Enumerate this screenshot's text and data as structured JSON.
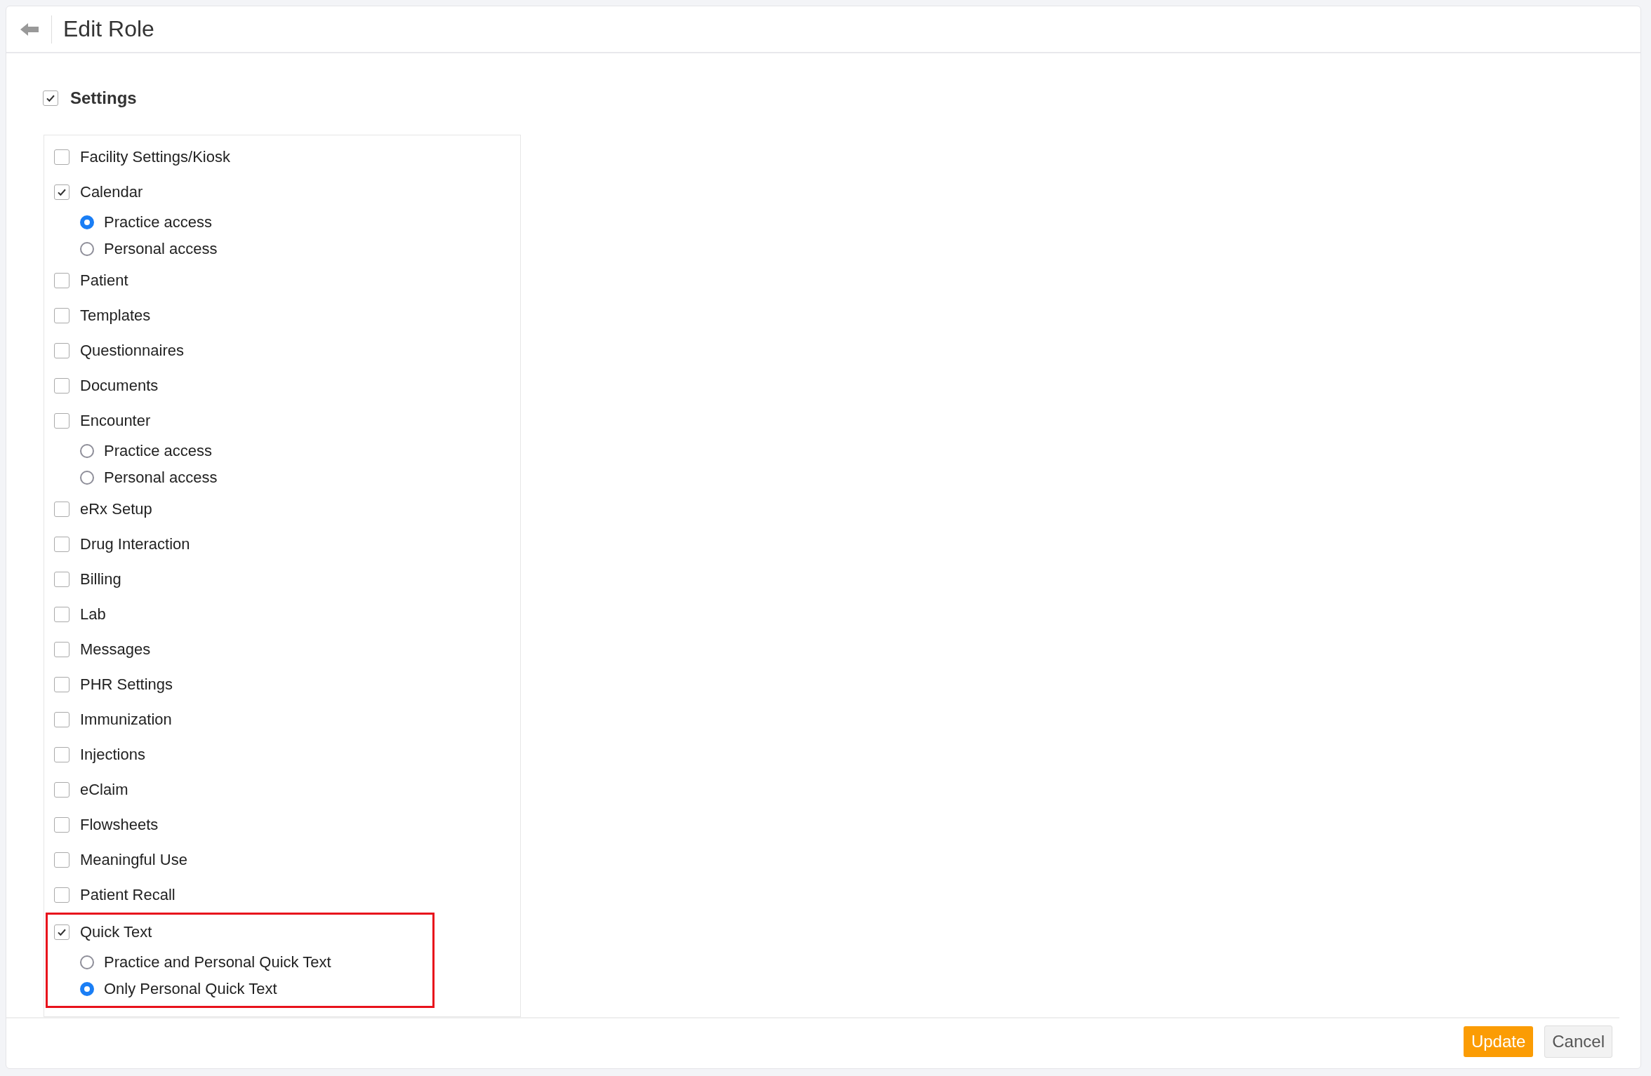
{
  "header": {
    "title": "Edit Role"
  },
  "settings": {
    "label": "Settings",
    "checked": true,
    "items": [
      {
        "label": "Facility Settings/Kiosk",
        "checked": false,
        "highlighted": false
      },
      {
        "label": "Calendar",
        "checked": true,
        "highlighted": false,
        "options": [
          {
            "label": "Practice access",
            "selected": true
          },
          {
            "label": "Personal access",
            "selected": false
          }
        ]
      },
      {
        "label": "Patient",
        "checked": false,
        "highlighted": false
      },
      {
        "label": "Templates",
        "checked": false,
        "highlighted": false
      },
      {
        "label": "Questionnaires",
        "checked": false,
        "highlighted": false
      },
      {
        "label": "Documents",
        "checked": false,
        "highlighted": false
      },
      {
        "label": "Encounter",
        "checked": false,
        "highlighted": false,
        "options": [
          {
            "label": "Practice access",
            "selected": false
          },
          {
            "label": "Personal access",
            "selected": false
          }
        ]
      },
      {
        "label": "eRx Setup",
        "checked": false,
        "highlighted": false
      },
      {
        "label": "Drug Interaction",
        "checked": false,
        "highlighted": false
      },
      {
        "label": "Billing",
        "checked": false,
        "highlighted": false
      },
      {
        "label": "Lab",
        "checked": false,
        "highlighted": false
      },
      {
        "label": "Messages",
        "checked": false,
        "highlighted": false
      },
      {
        "label": "PHR Settings",
        "checked": false,
        "highlighted": false
      },
      {
        "label": "Immunization",
        "checked": false,
        "highlighted": false
      },
      {
        "label": "Injections",
        "checked": false,
        "highlighted": false
      },
      {
        "label": "eClaim",
        "checked": false,
        "highlighted": false
      },
      {
        "label": "Flowsheets",
        "checked": false,
        "highlighted": false
      },
      {
        "label": "Meaningful Use",
        "checked": false,
        "highlighted": false
      },
      {
        "label": "Patient Recall",
        "checked": false,
        "highlighted": false
      },
      {
        "label": "Quick Text",
        "checked": true,
        "highlighted": true,
        "options": [
          {
            "label": "Practice and Personal Quick Text",
            "selected": false
          },
          {
            "label": "Only Personal Quick Text",
            "selected": true
          }
        ]
      }
    ]
  },
  "buttons": {
    "primary": "Update",
    "secondary": "Cancel"
  }
}
